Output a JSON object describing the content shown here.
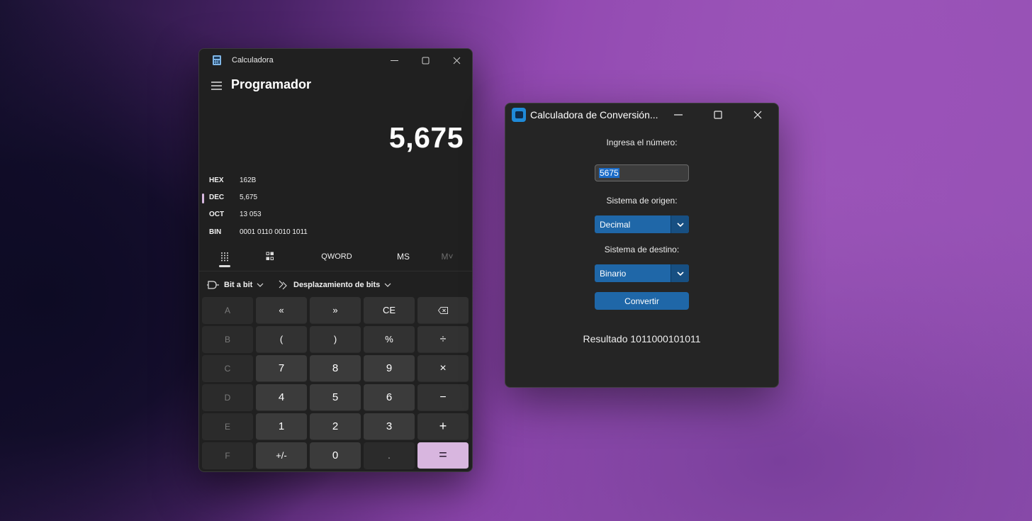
{
  "calculator": {
    "window_title": "Calculadora",
    "mode": "Programador",
    "display": "5,675",
    "radix": [
      {
        "label": "HEX",
        "value": "162B",
        "active": false
      },
      {
        "label": "DEC",
        "value": "5,675",
        "active": true
      },
      {
        "label": "OCT",
        "value": "13 053",
        "active": false
      },
      {
        "label": "BIN",
        "value": "0001 0110 0010 1011",
        "active": false
      }
    ],
    "modebar": {
      "word_size": "QWORD",
      "memory_store": "MS",
      "memory_menu": "M˅"
    },
    "opbar": {
      "bitwise": "Bit a bit",
      "bitshift": "Desplazamiento de bits"
    },
    "keys": [
      [
        "A",
        "«",
        "»",
        "CE",
        "⌫"
      ],
      [
        "B",
        "(",
        ")",
        "%",
        "÷"
      ],
      [
        "C",
        "7",
        "8",
        "9",
        "×"
      ],
      [
        "D",
        "4",
        "5",
        "6",
        "−"
      ],
      [
        "E",
        "1",
        "2",
        "3",
        "+"
      ],
      [
        "F",
        "+/-",
        "0",
        ".",
        "="
      ]
    ],
    "accent_color": "#d8b6df"
  },
  "converter": {
    "window_title": "Calculadora de Conversión...",
    "input_label": "Ingresa el número:",
    "input_value": "5675",
    "origin_label": "Sistema de origen:",
    "origin_value": "Decimal",
    "dest_label": "Sistema de destino:",
    "dest_value": "Binario",
    "convert_button": "Convertir",
    "result_text": "Resultado 1011000101011",
    "accent_color": "#1f67a8"
  }
}
